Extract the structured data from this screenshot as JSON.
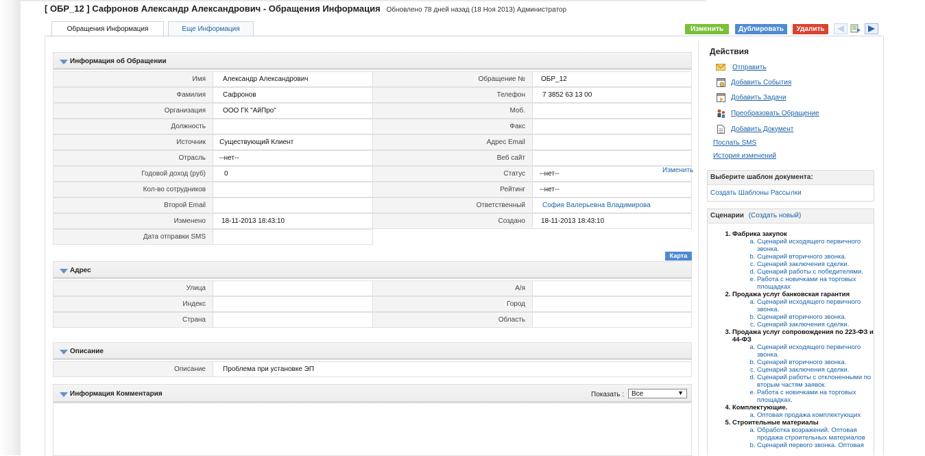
{
  "header": {
    "title": "[ ОБР_12 ] Сафронов Александр Александрович - Обращения Информация",
    "updated": "Обновлено 78 дней назад (18 Ноя 2013) Администратор"
  },
  "tabs": [
    {
      "label": "Обращения Информация",
      "active": true
    },
    {
      "label": "Еще Информация",
      "active": false
    }
  ],
  "toolbar": {
    "edit_label": "Изменить",
    "duplicate_label": "Дублировать",
    "delete_label": "Удалить",
    "edit_color": "#7bbf3a",
    "duplicate_color": "#4f8ad1",
    "delete_color": "#d9432f"
  },
  "info_section": {
    "title": "Информация об Обращении",
    "fields": {
      "first_name": {
        "label": "Имя",
        "value": "Александр Александрович"
      },
      "last_name": {
        "label": "Фамилия",
        "value": "Сафронов"
      },
      "organization": {
        "label": "Организация",
        "value": "ООО ГК \"АйПро\""
      },
      "position": {
        "label": "Должность",
        "value": ""
      },
      "source": {
        "label": "Источник",
        "value": "Существующий Клиент"
      },
      "industry": {
        "label": "Отрасль",
        "value": "--нет--"
      },
      "annual_income": {
        "label": "Годовой доход (руб)",
        "value": "0"
      },
      "employees": {
        "label": "Кол-во сотрудников",
        "value": ""
      },
      "second_email": {
        "label": "Второй Email",
        "value": ""
      },
      "modified": {
        "label": "Изменено",
        "value": "18-11-2013 18:43:10"
      },
      "sms_date": {
        "label": "Дата отправки SMS",
        "value": ""
      },
      "lead_no": {
        "label": "Обращение №",
        "value": "ОБР_12"
      },
      "phone": {
        "label": "Телефон",
        "value": "7 3852 63 13 00"
      },
      "mobile": {
        "label": "Моб.",
        "value": ""
      },
      "fax": {
        "label": "Факс",
        "value": ""
      },
      "email": {
        "label": "Адрес Email",
        "value": ""
      },
      "website": {
        "label": "Веб сайт",
        "value": ""
      },
      "status": {
        "label": "Статус",
        "value": "--нет--"
      },
      "rating": {
        "label": "Рейтинг",
        "value": "--нет--"
      },
      "owner": {
        "label": "Ответственный",
        "value": "София Валерьевна Владимирова"
      },
      "created": {
        "label": "Создано",
        "value": "18-11-2013 18:43:10"
      }
    },
    "status_edit_link": "Изменить",
    "map_button": "Карта"
  },
  "address_section": {
    "title": "Адрес",
    "fields": {
      "street": {
        "label": "Улица",
        "value": ""
      },
      "po_box": {
        "label": "А/я",
        "value": ""
      },
      "zip": {
        "label": "Индекс",
        "value": ""
      },
      "city": {
        "label": "Город",
        "value": ""
      },
      "country": {
        "label": "Страна",
        "value": ""
      },
      "state": {
        "label": "Область",
        "value": ""
      }
    }
  },
  "description_section": {
    "title": "Описание",
    "label": "Описание",
    "value": "Проблема при установке ЭП"
  },
  "comments_section": {
    "title": "Информация Комментария",
    "show_label": "Показать :",
    "show_value": "Все"
  },
  "sidebar": {
    "actions_title": "Действия",
    "actions": [
      {
        "label": "Отправить",
        "icon": "envelope-icon"
      },
      {
        "label": "Добавить События",
        "icon": "add-event-icon"
      },
      {
        "label": "Добавить Задачи",
        "icon": "add-task-icon"
      },
      {
        "label": "Преобразовать Обращение",
        "icon": "convert-lead-icon"
      },
      {
        "label": "Добавить Документ",
        "icon": "document-icon"
      }
    ],
    "send_sms": "Послать SMS",
    "history": "История изменений",
    "template_box": {
      "title": "Выберите шаблон документа:",
      "link": "Создать Шаблоны Рассылки"
    },
    "scenarios_box": {
      "title": "Сценарии",
      "create_link": "(Создать новый)",
      "groups": [
        {
          "name": "Фабрика закупок",
          "items": [
            "Сценарий исходящего первичного звонка.",
            "Сценарий вторичного звонка.",
            "Сценарий заключения сделки.",
            "Сценарий работы с победителями.",
            "Работа с новичками на торговых площадках"
          ]
        },
        {
          "name": "Продажа услуг банковская гарантия",
          "items": [
            "Сценарий исходящего первичного звонка.",
            "Сценарий вторичного звонка.",
            "Сценарий заключения сделки."
          ]
        },
        {
          "name": "Продажа услуг сопровождения по 223-ФЗ и 44-ФЗ",
          "items": [
            "Сценарий исходящего первичного звонка.",
            "Сценарий вторичного звонка.",
            "Сценарий заключения сделки.",
            "Сценарий работы с отклоненными по вторым частям заявок.",
            "Работа с новичками на торговых площадках."
          ]
        },
        {
          "name": "Комплектующие.",
          "items": [
            "Оптовая продажа комплектующих"
          ]
        },
        {
          "name": "Строительные материалы",
          "items": [
            "Обработка возражений. Оптовая продажа строительных материалов",
            "Сценарий первого звонка. Оптовая"
          ]
        }
      ]
    }
  }
}
